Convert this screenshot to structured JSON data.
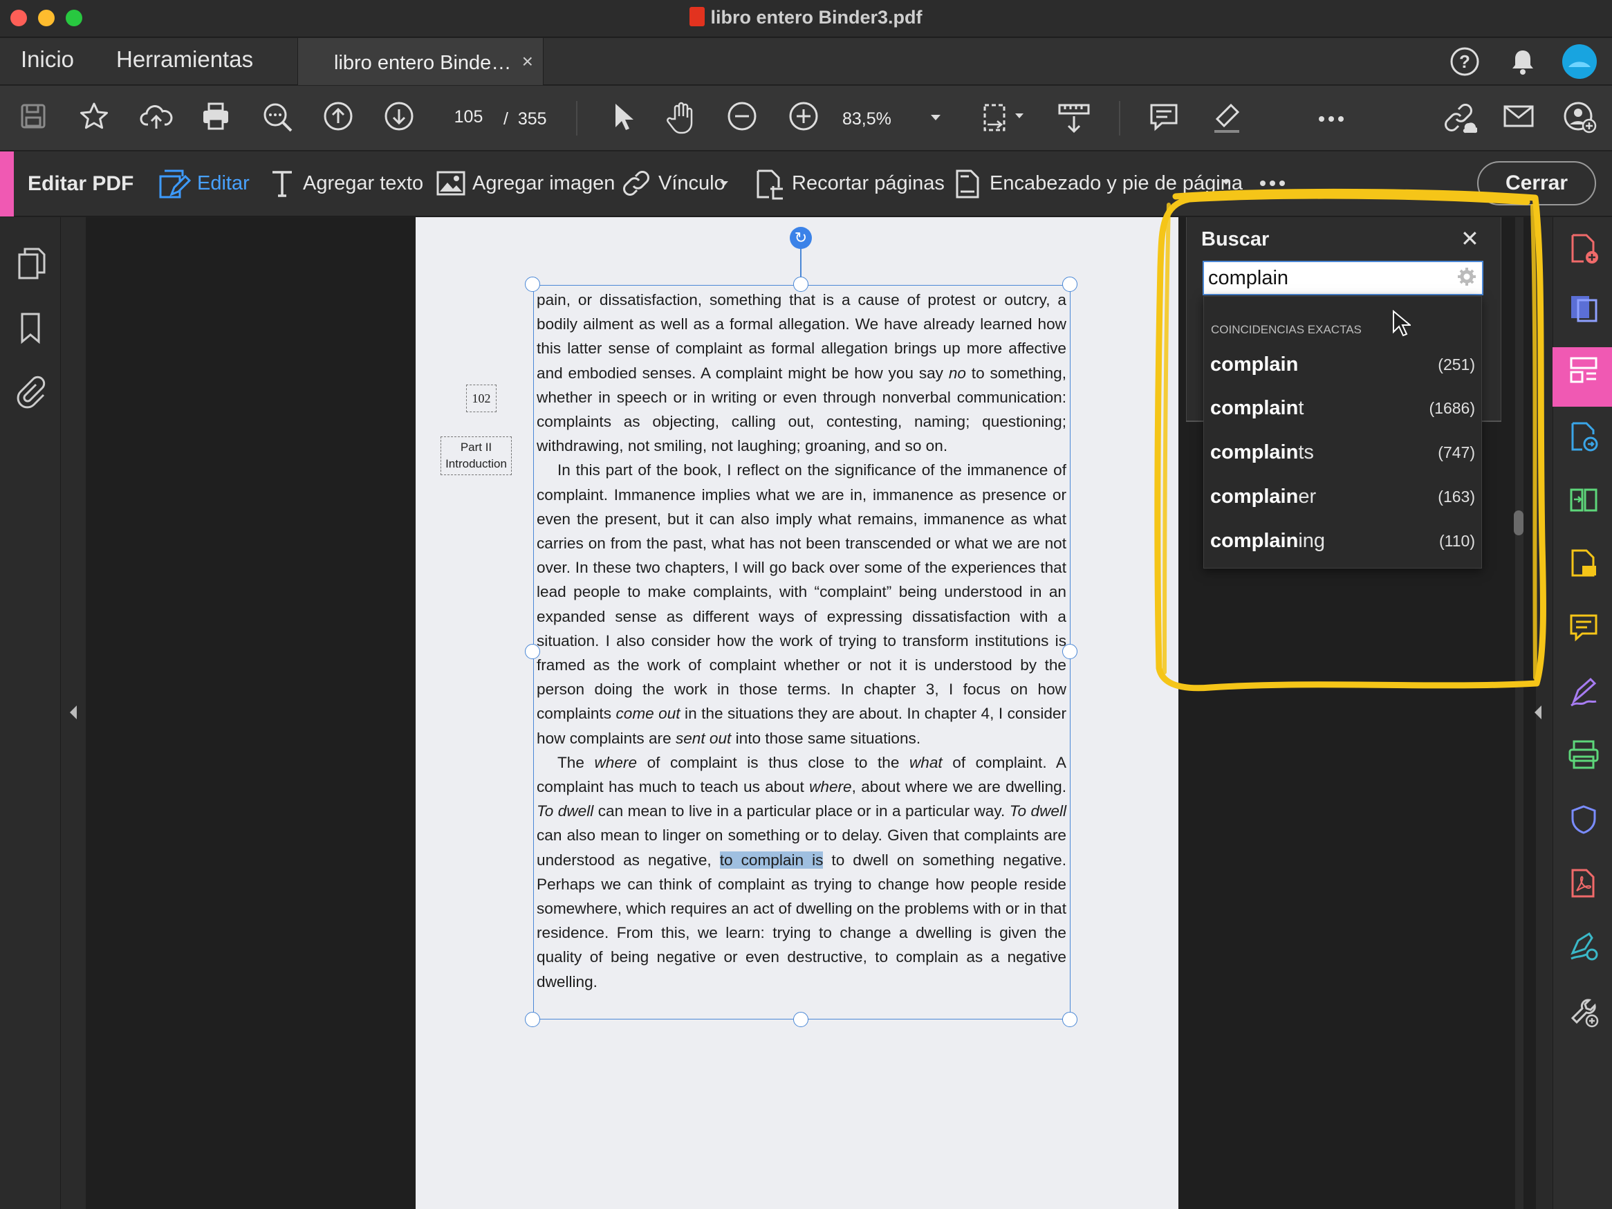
{
  "window": {
    "title": "libro entero Binder3.pdf"
  },
  "tabs": {
    "home": "Inicio",
    "tools": "Herramientas",
    "doc": "libro entero Binde…",
    "doc_close": "×"
  },
  "toolbar": {
    "page_current": "105",
    "page_sep": "/",
    "page_total": "355",
    "zoom": "83,5%"
  },
  "editbar": {
    "title": "Editar PDF",
    "edit": "Editar",
    "add_text": "Agregar texto",
    "add_image": "Agregar imagen",
    "link": "Vínculo",
    "crop": "Recortar páginas",
    "header_footer": "Encabezado y pie de página",
    "close": "Cerrar"
  },
  "colors": {
    "accent": "#f059b3",
    "selection": "#4a87d6",
    "highlight": "#f5c518"
  },
  "page": {
    "page_number": "102",
    "running_head_line1": "Part II",
    "running_head_line2": "Introduction",
    "para1": "pain, or dissatisfaction, something that is a cause of protest or outcry, a bodily ailment as well as a formal allegation. We have already learned how this latter sense of complaint as formal allegation brings up more affective and embodied senses. A complaint might be how you say ",
    "para1_em": "no",
    "para1_end": " to something, whether in speech or in writing or even through nonverbal communication: complaints as objecting, calling out, contesting, naming; questioning; withdrawing, not smiling, not laughing; groaning, and so on.",
    "para2a": "In this part of the book, I reflect on the significance of the immanence of complaint. Immanence implies what we are in, immanence as presence or even the present, but it can also imply what remains, immanence as what carries on from the past, what has not been transcended or what we are not over. In these two chapters, I will go back over some of the experiences that lead people to make complaints, with “complaint” being understood in an expanded sense as different ways of expressing dissatisfaction with a situation. I also consider how the work of trying to transform institutions is framed as the work of complaint whether or not it is understood by the person doing the work in those terms. In chapter 3, I focus on how complaints ",
    "para2_em1": "come out",
    "para2b": " in the situations they are about. In chapter 4, I consider how complaints are ",
    "para2_em2": "sent out",
    "para2c": " into those same situations.",
    "para3a": "The ",
    "para3_em1": "where",
    "para3b": " of complaint is thus close to the ",
    "para3_em2": "what",
    "para3c": " of complaint. A complaint has much to teach us about ",
    "para3_em3": "where",
    "para3d": ", about where we are dwelling. ",
    "para3_em4": "To dwell",
    "para3e": " can mean to live in a particular place or in a particular way. ",
    "para3_em5": "To dwell",
    "para3f": " can also mean to linger on something or to delay. Given that complaints are understood as negative, ",
    "para3_hl": "to complain is",
    "para3g": " to dwell on something negative. Perhaps we can think of complaint as trying to change how people reside somewhere, which requires an act of dwelling on the problems with or in that residence. From this, we learn: trying to change a dwelling is given the quality of being negative or even destructive, to complain as a negative dwelling."
  },
  "search": {
    "title": "Buscar",
    "close": "✕",
    "query": "complain",
    "section_label": "COINCIDENCIAS EXACTAS",
    "suggestions": [
      {
        "match": "complain",
        "rest": "",
        "count": "(251)"
      },
      {
        "match": "complain",
        "rest": "t",
        "count": "(1686)"
      },
      {
        "match": "complain",
        "rest": "ts",
        "count": "(747)"
      },
      {
        "match": "complain",
        "rest": "er",
        "count": "(163)"
      },
      {
        "match": "complain",
        "rest": "ing",
        "count": "(110)"
      }
    ]
  }
}
